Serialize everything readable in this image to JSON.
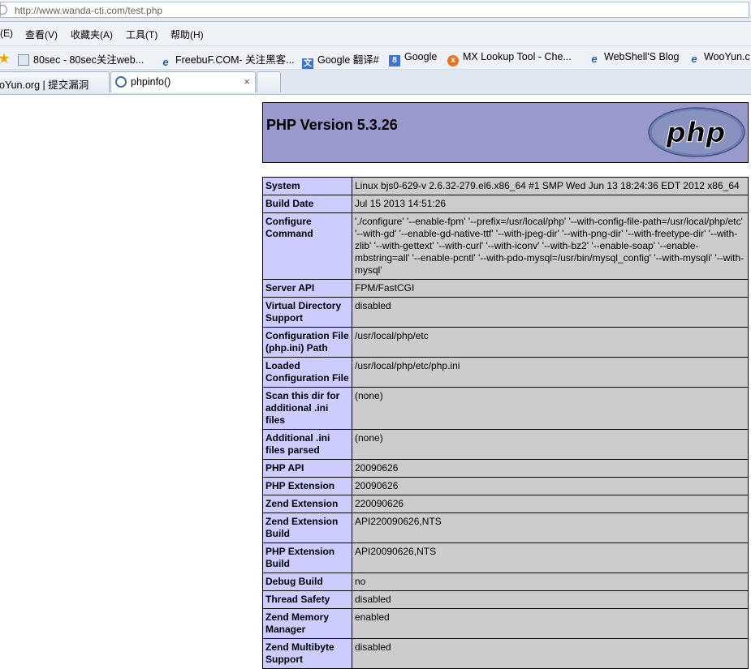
{
  "browser": {
    "url": "http://www.wanda-cti.com/test.php",
    "menu": [
      "(E)",
      "查看(V)",
      "收藏夹(A)",
      "工具(T)",
      "帮助(H)"
    ],
    "favorites": [
      {
        "label": "80sec - 80sec关注web...",
        "icon": "page-icon"
      },
      {
        "label": "FreebuF.COM- 关注黑客...",
        "icon": "ie-icon"
      },
      {
        "label": "Google 翻译#",
        "icon": "translate-icon"
      },
      {
        "label": "Google",
        "icon": "google-icon"
      },
      {
        "label": "MX Lookup Tool - Che...",
        "icon": "mxtoolbox-icon"
      },
      {
        "label": "WebShell'S Blog",
        "icon": "ie-icon"
      },
      {
        "label": "WooYun.c",
        "icon": "ie-icon"
      }
    ],
    "tabs": [
      {
        "label": "oYun.org | 提交漏洞"
      },
      {
        "label": "phpinfo()",
        "active": true
      }
    ],
    "close_glyph": "×"
  },
  "page": {
    "title": "PHP Version 5.3.26",
    "logo_text": "php",
    "rows": [
      {
        "key": "System",
        "value": "Linux bjs0-629-v 2.6.32-279.el6.x86_64 #1 SMP Wed Jun 13 18:24:36 EDT 2012 x86_64"
      },
      {
        "key": "Build Date",
        "value": "Jul 15 2013 14:51:26"
      },
      {
        "key": "Configure Command",
        "value": "'./configure' '--enable-fpm' '--prefix=/usr/local/php' '--with-config-file-path=/usr/local/php/etc' '--with-gd' '--enable-gd-native-ttf' '--with-jpeg-dir' '--with-png-dir' '--with-freetype-dir' '--with-zlib' '--with-gettext' '--with-curl' '--with-iconv' '--with-bz2' '--enable-soap' '--enable-mbstring=all' '--enable-pcntl' '--with-pdo-mysql=/usr/bin/mysql_config' '--with-mysqli' '--with-mysql'"
      },
      {
        "key": "Server API",
        "value": "FPM/FastCGI"
      },
      {
        "key": "Virtual Directory Support",
        "value": "disabled"
      },
      {
        "key": "Configuration File (php.ini) Path",
        "value": "/usr/local/php/etc"
      },
      {
        "key": "Loaded Configuration File",
        "value": "/usr/local/php/etc/php.ini"
      },
      {
        "key": "Scan this dir for additional .ini files",
        "value": "(none)"
      },
      {
        "key": "Additional .ini files parsed",
        "value": "(none)"
      },
      {
        "key": "PHP API",
        "value": "20090626"
      },
      {
        "key": "PHP Extension",
        "value": "20090626"
      },
      {
        "key": "Zend Extension",
        "value": "220090626"
      },
      {
        "key": "Zend Extension Build",
        "value": "API220090626,NTS"
      },
      {
        "key": "PHP Extension Build",
        "value": "API20090626,NTS"
      },
      {
        "key": "Debug Build",
        "value": "no"
      },
      {
        "key": "Thread Safety",
        "value": "disabled"
      },
      {
        "key": "Zend Memory Manager",
        "value": "enabled"
      },
      {
        "key": "Zend Multibyte Support",
        "value": "disabled"
      }
    ]
  },
  "colors": {
    "header_bg": "#9999cc",
    "key_bg": "#ccccff",
    "value_bg": "#cccccc"
  }
}
